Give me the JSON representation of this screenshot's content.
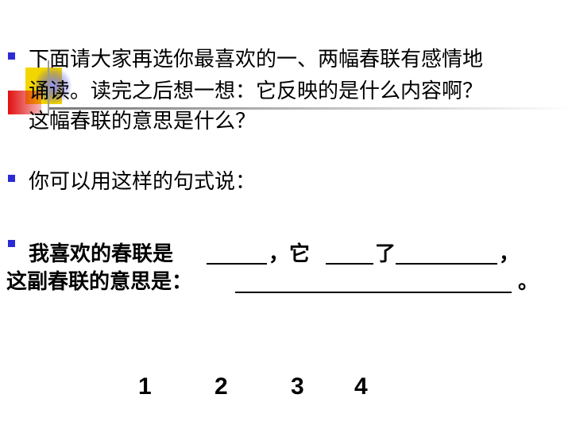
{
  "bullet1": {
    "line1": "下面请大家再选你最喜欢的一、两幅春联有感情地",
    "line2": "诵读。读完之后想一想：它反映的是什么内容啊？",
    "line3": "这幅春联的意思是什么？"
  },
  "bullet2": {
    "text": "你可以用这样的句式说："
  },
  "bullet3": {
    "part1": "我喜欢的春联是",
    "part2": "，它",
    "part3": "了",
    "part4": "，",
    "line2_prefix": "这副春联的意思是：",
    "line2_suffix": "。"
  },
  "numbers": [
    "1",
    "2",
    "3",
    "4"
  ],
  "colors": {
    "bullet": "#2b2bd6",
    "deco_yellow": "#f2d600",
    "deco_red": "#e01010",
    "deco_blue": "#2a2ad0"
  }
}
